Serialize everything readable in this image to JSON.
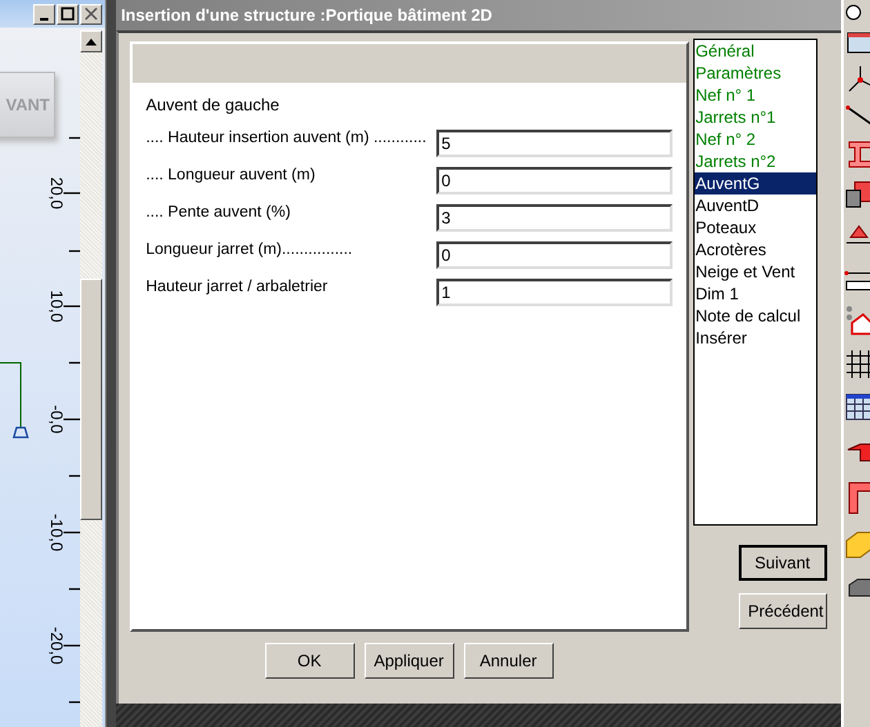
{
  "canvas": {
    "button_label": "VANT",
    "axis_labels": [
      "20,0",
      "10,0",
      "-0,0",
      "-10,0",
      "-20,0"
    ]
  },
  "dialog": {
    "title": "Insertion d'une structure :Portique bâtiment 2D",
    "section": "Auvent de gauche",
    "fields": [
      {
        "label": ".... Hauteur insertion auvent (m) ............",
        "value": "5"
      },
      {
        "label": ".... Longueur auvent (m)",
        "value": "0"
      },
      {
        "label": ".... Pente auvent (%)",
        "value": "3"
      },
      {
        "label": "Longueur jarret (m)................",
        "value": "0"
      },
      {
        "label": "Hauteur jarret /  arbaletrier",
        "value": "1"
      }
    ],
    "steps": [
      {
        "label": "Général",
        "done": true,
        "selected": false
      },
      {
        "label": "Paramètres",
        "done": true,
        "selected": false
      },
      {
        "label": "Nef n° 1",
        "done": true,
        "selected": false
      },
      {
        "label": "Jarrets n°1",
        "done": true,
        "selected": false
      },
      {
        "label": "Nef n° 2",
        "done": true,
        "selected": false
      },
      {
        "label": "Jarrets n°2",
        "done": true,
        "selected": false
      },
      {
        "label": "AuventG",
        "done": false,
        "selected": true
      },
      {
        "label": "AuventD",
        "done": false,
        "selected": false
      },
      {
        "label": "Poteaux",
        "done": false,
        "selected": false
      },
      {
        "label": "Acrotères",
        "done": false,
        "selected": false
      },
      {
        "label": "Neige et Vent",
        "done": false,
        "selected": false
      },
      {
        "label": "Dim 1",
        "done": false,
        "selected": false
      },
      {
        "label": "Note de calcul",
        "done": false,
        "selected": false
      },
      {
        "label": "Insérer",
        "done": false,
        "selected": false
      }
    ],
    "nav_buttons": [
      {
        "label": "Suivant",
        "default": true
      },
      {
        "label": "Précédent",
        "default": false
      }
    ],
    "buttons": [
      "OK",
      "Appliquer",
      "Annuler"
    ]
  }
}
